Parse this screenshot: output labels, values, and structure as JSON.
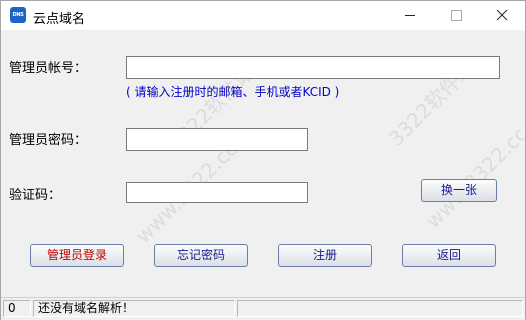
{
  "window": {
    "icon_text": "DNS",
    "title": "云点域名"
  },
  "form": {
    "account_label": "管理员帐号：",
    "account_value": "",
    "hint": "( 请输入注册时的邮箱、手机或者KCID )",
    "password_label": "管理员密码：",
    "password_value": "",
    "captcha_label": "验证码：",
    "captcha_value": ""
  },
  "buttons": {
    "refresh_captcha": "换一张",
    "login": "管理员登录",
    "forgot_password": "忘记密码",
    "register": "注册",
    "back": "返回"
  },
  "status": {
    "count": "0",
    "message": "还没有域名解析！"
  },
  "watermark": {
    "text_1": "3322软件站",
    "text_2": "www.3322.cc",
    "text_3": "3322软件站",
    "text_4": "www.3322.cc"
  },
  "colors": {
    "hint": "#0000c8",
    "login_button_text": "#c00000",
    "button_text": "#1a1a8c",
    "app_icon": "#1e63c6"
  }
}
